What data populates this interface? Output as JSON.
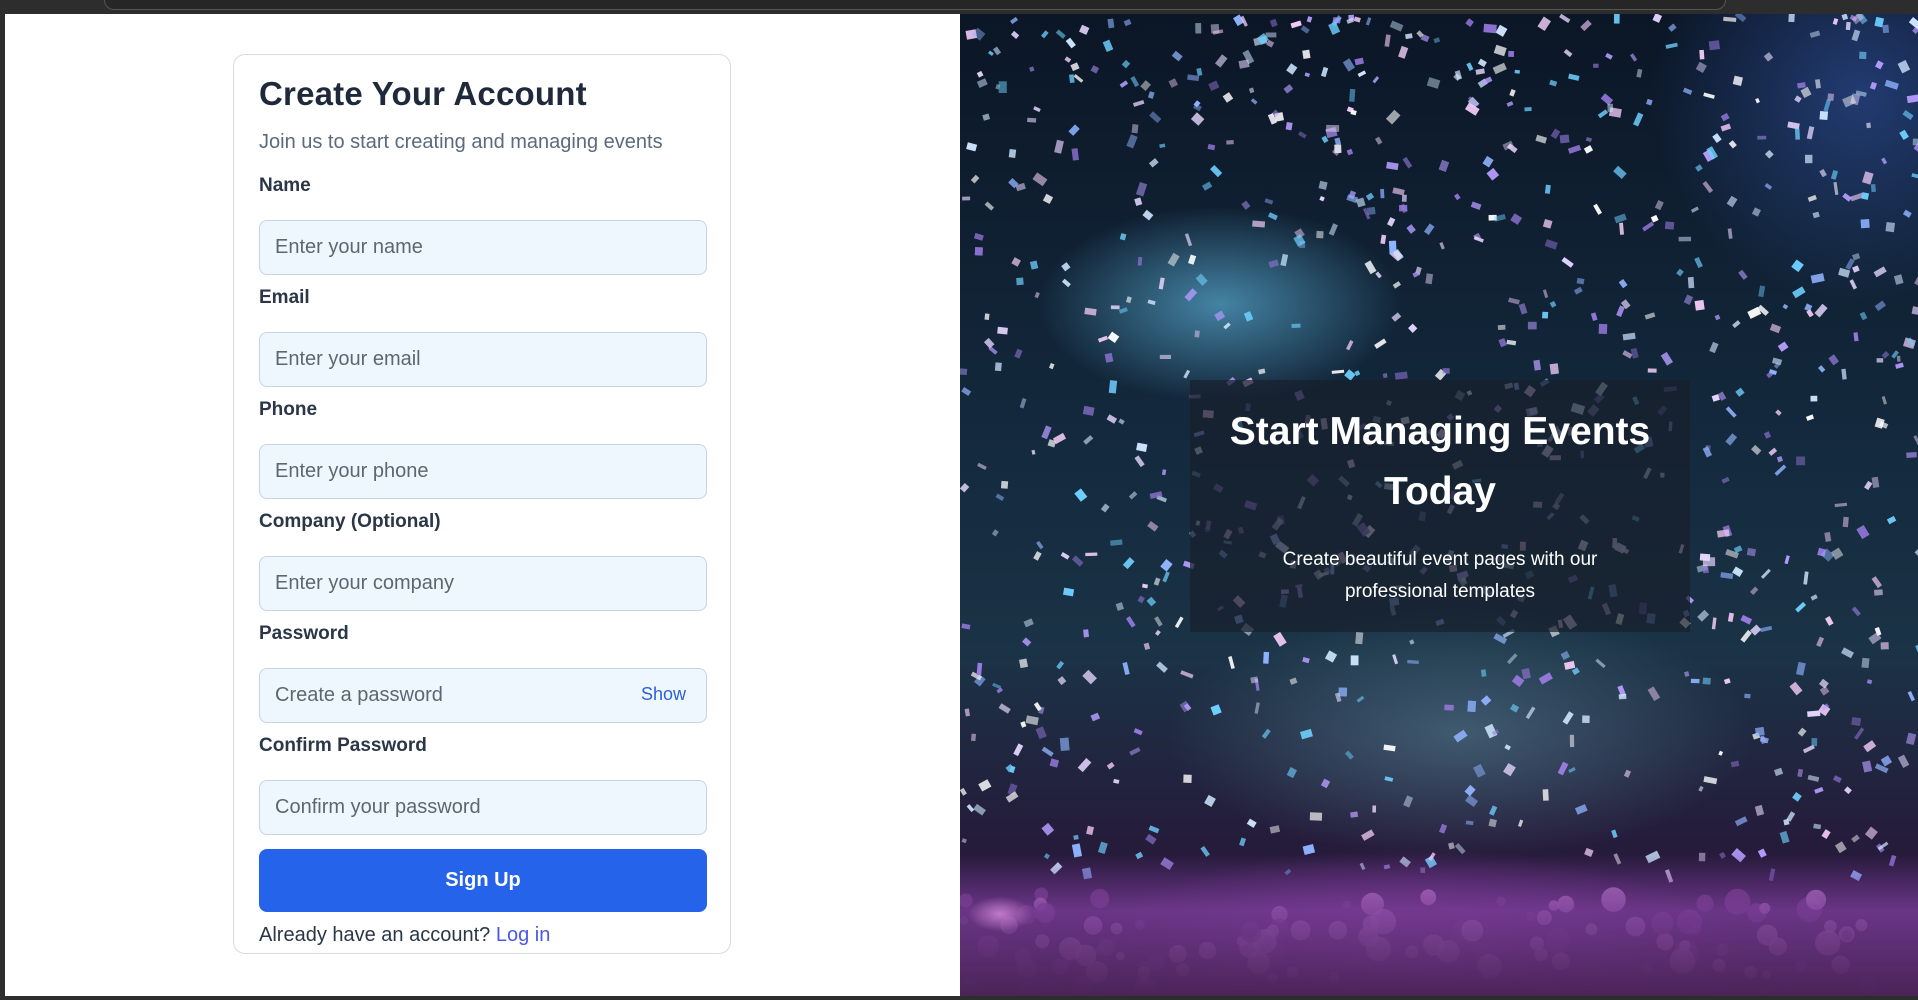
{
  "form": {
    "title": "Create Your Account",
    "subtitle": "Join us to start creating and managing events",
    "fields": [
      {
        "label": "Name",
        "placeholder": "Enter your name"
      },
      {
        "label": "Email",
        "placeholder": "Enter your email"
      },
      {
        "label": "Phone",
        "placeholder": "Enter your phone"
      },
      {
        "label": "Company (Optional)",
        "placeholder": "Enter your company"
      },
      {
        "label": "Password",
        "placeholder": "Create a password"
      },
      {
        "label": "Confirm Password",
        "placeholder": "Confirm your password"
      }
    ],
    "show_password_label": "Show",
    "submit_label": "Sign Up",
    "login_prompt": "Already have an account?",
    "login_link": "Log in"
  },
  "hero": {
    "title": "Start Managing Events Today",
    "subtitle": "Create beautiful event pages with our professional templates"
  },
  "colors": {
    "primary_button": "#2563eb",
    "link": "#4a58e8",
    "field_background": "#eff7fe"
  }
}
